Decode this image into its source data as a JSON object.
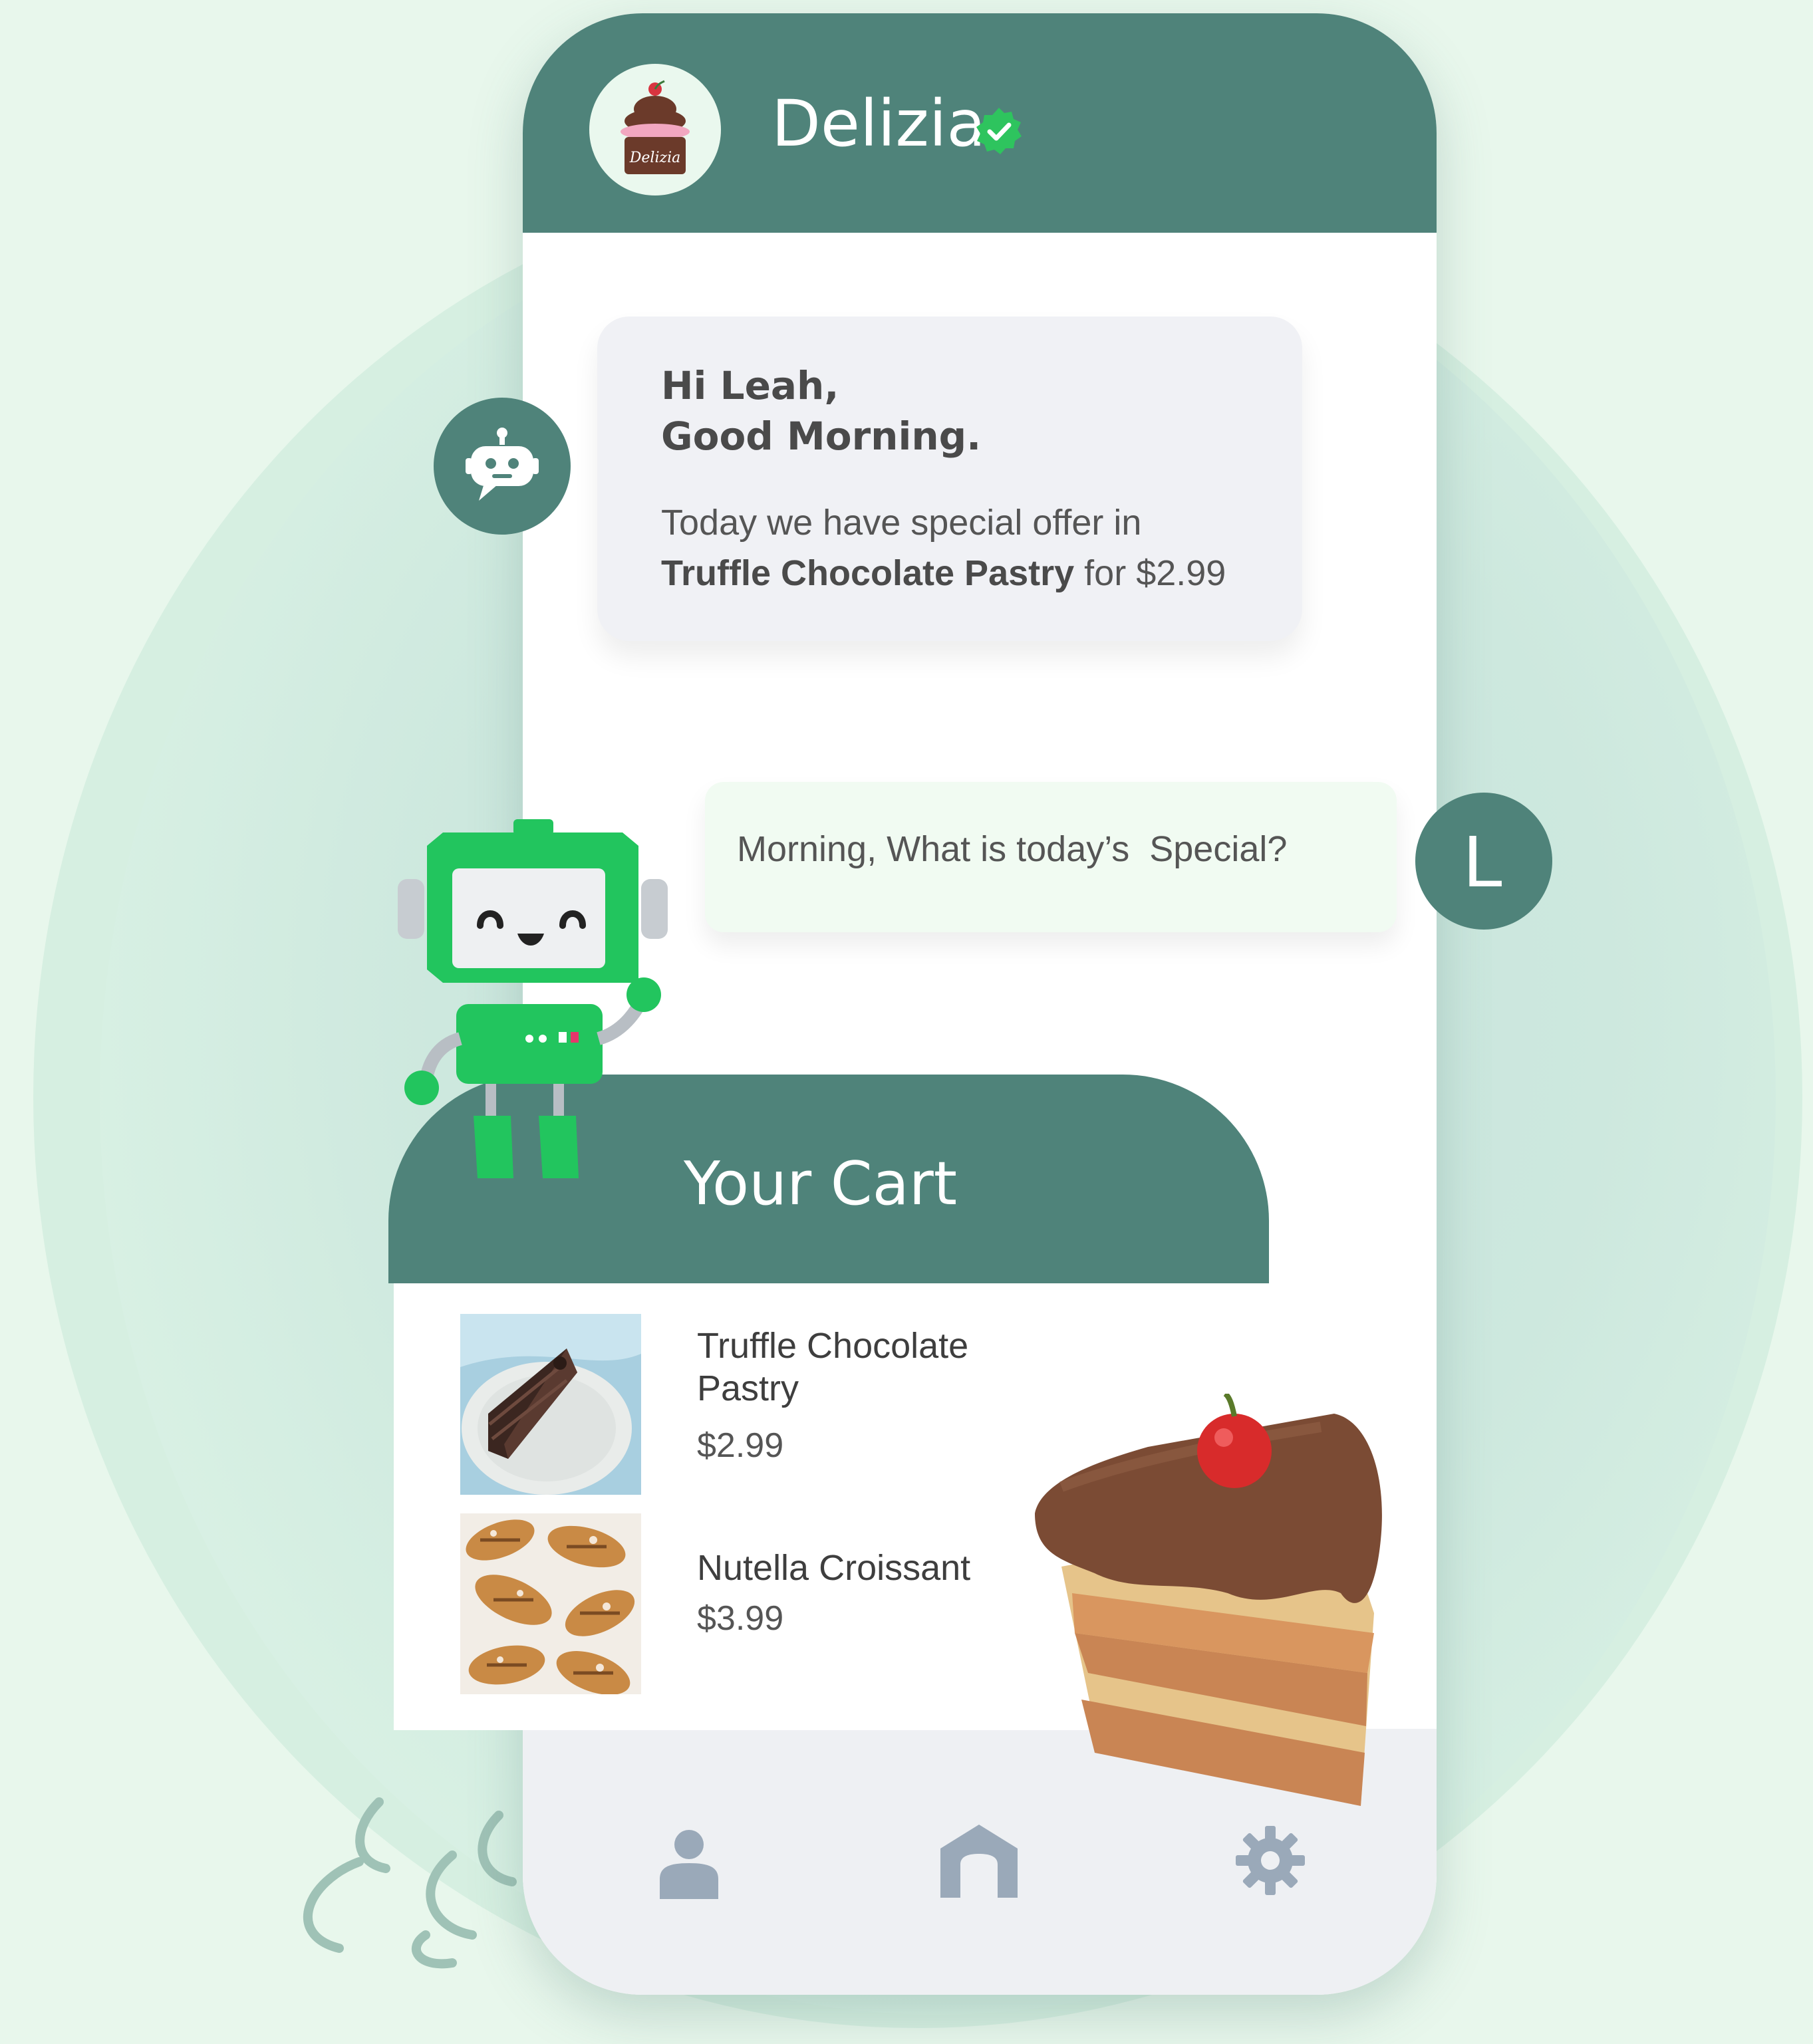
{
  "app": {
    "name": "Delizia",
    "logo_text": "Delizia",
    "verified_icon": "verified-badge-icon"
  },
  "chat": {
    "bot_avatar_icon": "chatbot-icon",
    "bot_greeting": "Hi Leah,\nGood Morning.",
    "bot_offer_prefix": "Today we have special offer in",
    "bot_offer_item": "Truffle Chocolate Pastry",
    "bot_offer_suffix": " for $2.99",
    "user_initial": "L",
    "user_message": "Morning, What is today’s  Special?"
  },
  "cart": {
    "title": "Your Cart",
    "items": [
      {
        "name": "Truffle Chocolate\nPastry",
        "price": "$2.99",
        "image": "chocolate-pastry-photo"
      },
      {
        "name": "Nutella Croissant",
        "price": "$3.99",
        "image": "croissant-photo"
      }
    ]
  },
  "tabbar": {
    "items": [
      {
        "icon": "profile-icon"
      },
      {
        "icon": "home-icon"
      },
      {
        "icon": "settings-icon"
      }
    ]
  },
  "colors": {
    "brand": "#4f837a",
    "verified": "#2ec45e",
    "bot_bubble": "#f0f1f5",
    "user_bubble": "#f1fbf2",
    "tab_icon": "#9aa9b9"
  }
}
